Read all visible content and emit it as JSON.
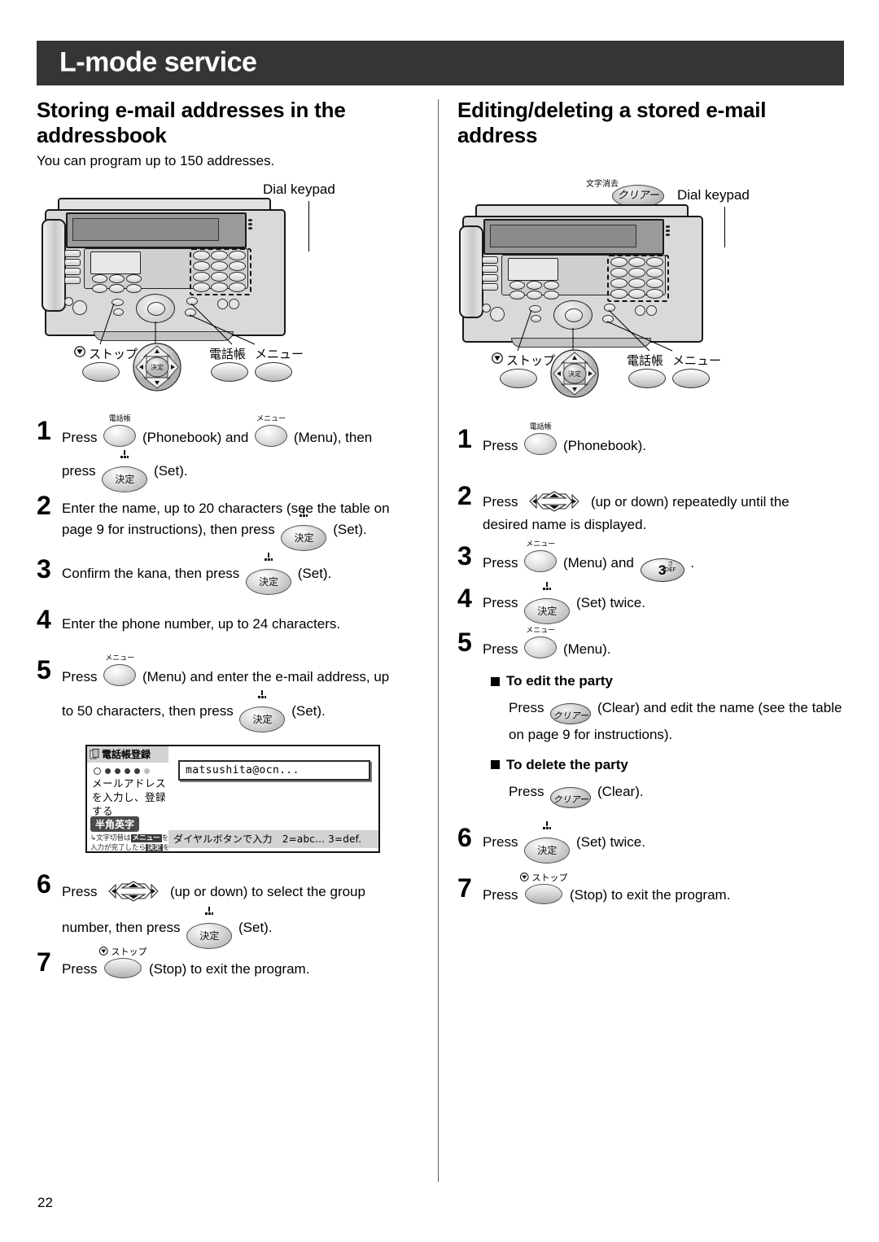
{
  "header": {
    "title": "L-mode service"
  },
  "page_number": "22",
  "left": {
    "section_title": "Storing e-mail addresses in the addressbook",
    "intro": "You can program up to 150 addresses.",
    "figure": {
      "dial_keypad_label": "Dial keypad",
      "legend": [
        {
          "name": "stop",
          "jp": "ストップ"
        },
        {
          "name": "navigator",
          "jp": "決定"
        },
        {
          "name": "phonebook",
          "jp": "電話帳"
        },
        {
          "name": "menu",
          "jp": "メニュー"
        }
      ]
    },
    "steps": [
      {
        "num": "1",
        "line1_pre": "Press",
        "key1_cap": "電話帳",
        "line1_mid": "(Phonebook) and",
        "key2_cap": "メニュー",
        "line1_post": "(Menu), then",
        "line2_pre": "press",
        "key3_label": "決定",
        "line2_post": "(Set)."
      },
      {
        "num": "2",
        "text_pre": "Enter the name, up to 20 characters (see the table on page 9 for instructions), then press",
        "key_label": "決定",
        "text_post": "(Set)."
      },
      {
        "num": "3",
        "text_pre": "Confirm the kana, then press",
        "key_label": "決定",
        "text_post": "(Set)."
      },
      {
        "num": "4",
        "text_pre": "Enter the phone number, up to 24 characters."
      },
      {
        "num": "5",
        "line1_pre": "Press",
        "key1_cap": "メニュー",
        "line1_post": "(Menu) and enter the e-mail address, up",
        "line2_pre": "to 50 characters, then press",
        "key2_label": "決定",
        "line2_post": "(Set)."
      },
      {
        "num": "6",
        "line1_pre": "Press",
        "line1_post": "(up or down) to select the group",
        "line2_pre": "number, then press",
        "key_label": "決定",
        "line2_post": "(Set)."
      },
      {
        "num": "7",
        "text_pre": "Press",
        "key_cap": "ストップ",
        "text_post": "(Stop) to exit the program."
      }
    ],
    "lcd": {
      "title": "電話帳登録",
      "message": "メールアドレスを入力し、登録する",
      "mode": "半角英字",
      "hint1_pre": "文字切替は",
      "hint1_key": "メニュー",
      "hint1_post": "を押す",
      "hint2_pre": "入力が完了したら",
      "hint2_key": "決定",
      "hint2_post": "を押す",
      "input_value": "matsushita@ocn...",
      "footer": "ダイヤルボタンで入力　2=abc... 3=def."
    }
  },
  "right": {
    "section_title": "Editing/deleting a stored e-mail address",
    "figure": {
      "dial_keypad_label": "Dial keypad",
      "clear_key_jp": "クリアー",
      "clear_key_caption": "文字消去",
      "legend": [
        {
          "name": "stop",
          "jp": "ストップ"
        },
        {
          "name": "navigator",
          "jp": "決定"
        },
        {
          "name": "phonebook",
          "jp": "電話帳"
        },
        {
          "name": "menu",
          "jp": "メニュー"
        }
      ]
    },
    "steps": [
      {
        "num": "1",
        "text_pre": "Press",
        "key_cap": "電話帳",
        "text_post": "(Phonebook)."
      },
      {
        "num": "2",
        "line1_pre": "Press",
        "line1_post": "(up or down) repeatedly until the",
        "line2": "desired name is displayed."
      },
      {
        "num": "3",
        "text_pre": "Press",
        "key_cap": "メニュー",
        "text_mid": "(Menu) and",
        "num_key": "3",
        "num_key_jp": "さ",
        "num_key_en": "DEF",
        "text_post": "."
      },
      {
        "num": "4",
        "text_pre": "Press",
        "key_label": "決定",
        "text_post": "(Set) twice."
      },
      {
        "num": "5",
        "text_pre": "Press",
        "key_cap": "メニュー",
        "text_post": "(Menu)."
      }
    ],
    "edit_party": {
      "heading": "To edit the party",
      "body_pre": "Press",
      "key_label": "クリアー",
      "body_post": "(Clear) and edit the name (see the table on page 9 for instructions)."
    },
    "delete_party": {
      "heading": "To delete the party",
      "body_pre": "Press",
      "key_label": "クリアー",
      "body_post": "(Clear)."
    },
    "steps_tail": [
      {
        "num": "6",
        "text_pre": "Press",
        "key_label": "決定",
        "text_post": "(Set) twice."
      },
      {
        "num": "7",
        "text_pre": "Press",
        "key_cap": "ストップ",
        "text_post": "(Stop) to exit the program."
      }
    ]
  },
  "colors": {
    "header_bar": "#353535",
    "divider": "#5b5f63",
    "lcd_gray": "#d3d3d3",
    "body_text": "#000000"
  }
}
